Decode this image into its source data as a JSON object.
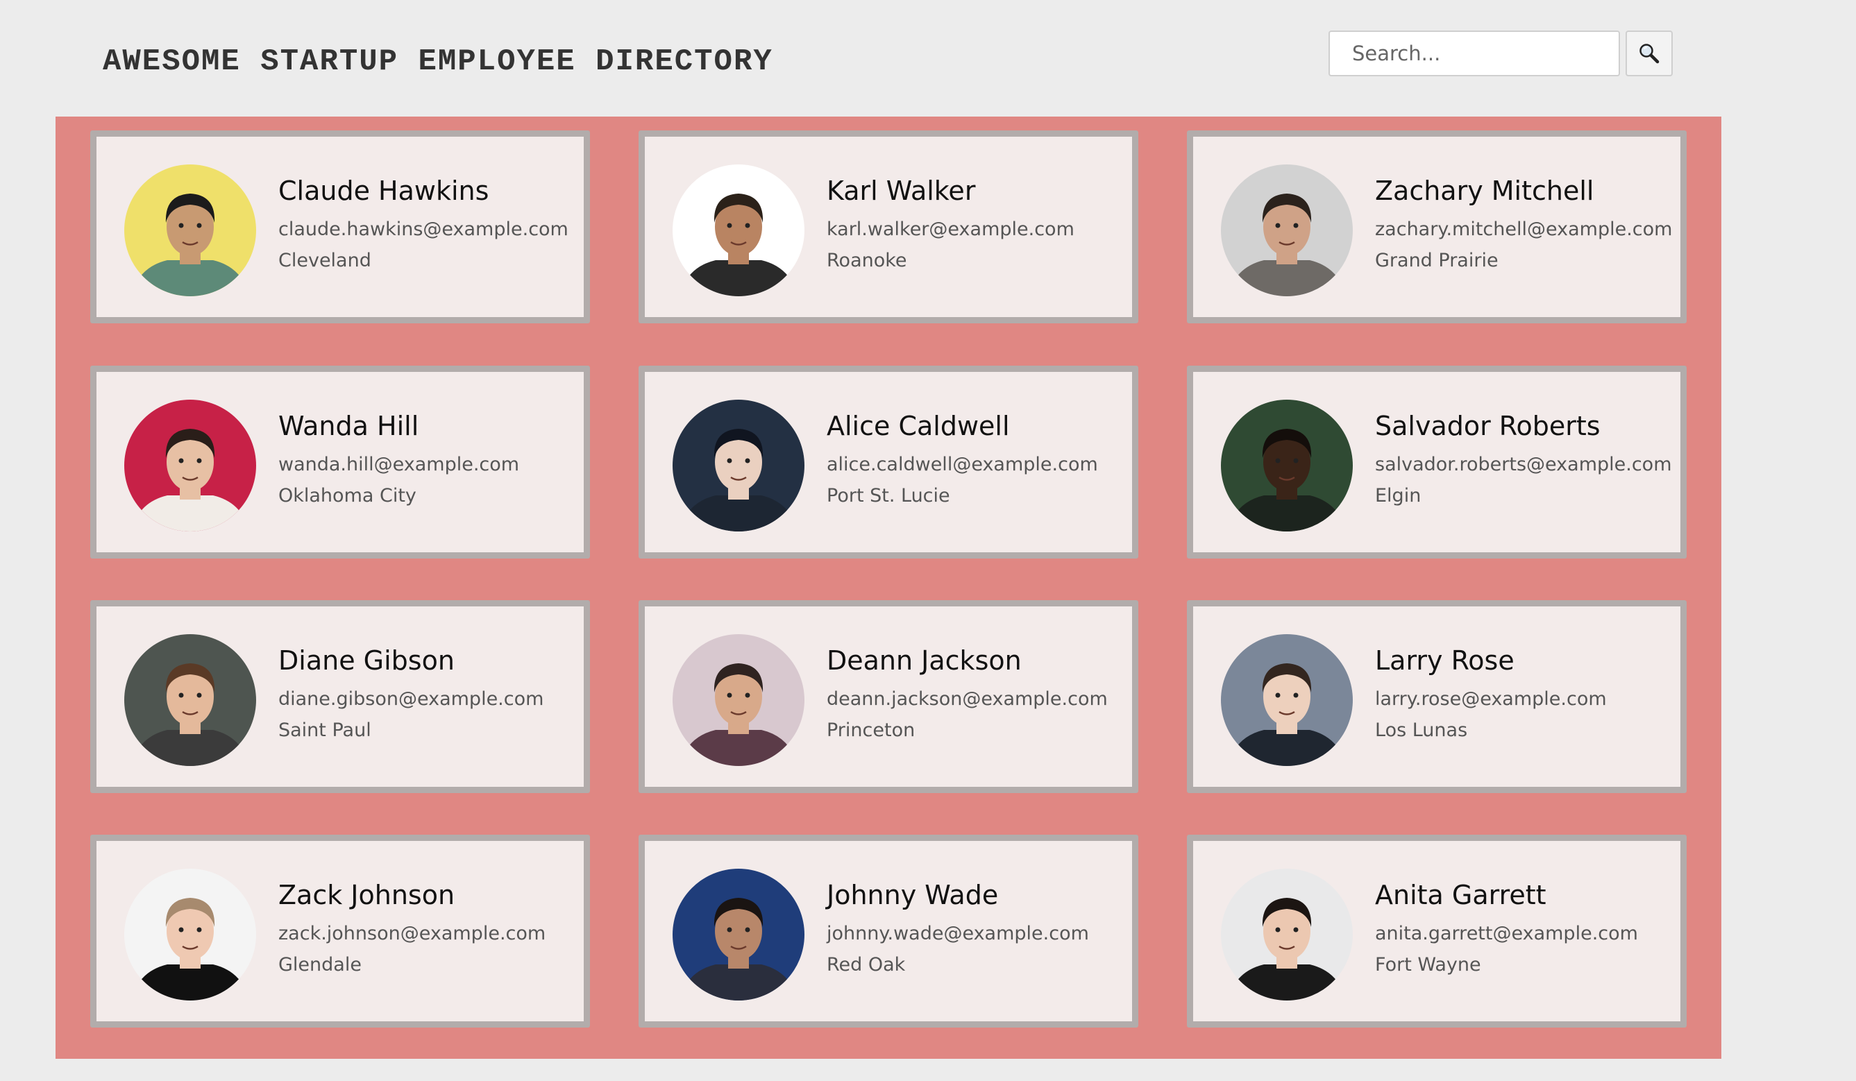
{
  "header": {
    "title": "AWESOME STARTUP EMPLOYEE DIRECTORY"
  },
  "search": {
    "placeholder": "Search...",
    "button_icon": "magnifier-icon"
  },
  "colors": {
    "page_background": "#ececec",
    "gallery_background": "#e08783",
    "card_background": "#f3ebea",
    "card_border": "#b2acab"
  },
  "employees": [
    {
      "name": "Claude Hawkins",
      "email": "claude.hawkins@example.com",
      "city": "Cleveland",
      "photo": "man-yellow-background",
      "bg": "#efe06a",
      "skin": "#c89a72",
      "hair": "#1b1b1b",
      "shirt": "#5d8a78"
    },
    {
      "name": "Karl Walker",
      "email": "karl.walker@example.com",
      "city": "Roanoke",
      "photo": "man-white-background",
      "bg": "#ffffff",
      "skin": "#b98462",
      "hair": "#2b2119",
      "shirt": "#2a2a2a"
    },
    {
      "name": "Zachary Mitchell",
      "email": "zachary.mitchell@example.com",
      "city": "Grand Prairie",
      "photo": "man-grey-background",
      "bg": "#d2d2d2",
      "skin": "#cfa287",
      "hair": "#2b221c",
      "shirt": "#6e6a66"
    },
    {
      "name": "Wanda Hill",
      "email": "wanda.hill@example.com",
      "city": "Oklahoma City",
      "photo": "woman-red-background",
      "bg": "#c72147",
      "skin": "#e7c0a4",
      "hair": "#2a1e19",
      "shirt": "#f1ece7"
    },
    {
      "name": "Alice Caldwell",
      "email": "alice.caldwell@example.com",
      "city": "Port St. Lucie",
      "photo": "woman-dark-background",
      "bg": "#233043",
      "skin": "#ead0c0",
      "hair": "#101520",
      "shirt": "#1d2633"
    },
    {
      "name": "Salvador Roberts",
      "email": "salvador.roberts@example.com",
      "city": "Elgin",
      "photo": "man-green-background",
      "bg": "#2f4a33",
      "skin": "#3a2418",
      "hair": "#140e0b",
      "shirt": "#1c241e"
    },
    {
      "name": "Diane Gibson",
      "email": "diane.gibson@example.com",
      "city": "Saint Paul",
      "photo": "woman-outdoor-background",
      "bg": "#4e5550",
      "skin": "#e4b99b",
      "hair": "#5a3a26",
      "shirt": "#3b3b3b"
    },
    {
      "name": "Deann Jackson",
      "email": "deann.jackson@example.com",
      "city": "Princeton",
      "photo": "woman-blossom-background",
      "bg": "#d8c8cf",
      "skin": "#d8a98a",
      "hair": "#2f2320",
      "shirt": "#5b3b48"
    },
    {
      "name": "Larry Rose",
      "email": "larry.rose@example.com",
      "city": "Los Lunas",
      "photo": "man-blue-grey-background",
      "bg": "#7b8799",
      "skin": "#edd0bd",
      "hair": "#33261f",
      "shirt": "#1f2630"
    },
    {
      "name": "Zack Johnson",
      "email": "zack.johnson@example.com",
      "city": "Glendale",
      "photo": "man-white-background",
      "bg": "#f4f4f4",
      "skin": "#efc9b2",
      "hair": "#a78a6e",
      "shirt": "#111111"
    },
    {
      "name": "Johnny Wade",
      "email": "johnny.wade@example.com",
      "city": "Red Oak",
      "photo": "man-blue-background",
      "bg": "#1f3d7a",
      "skin": "#b8876a",
      "hair": "#1a1412",
      "shirt": "#2a2e3d"
    },
    {
      "name": "Anita Garrett",
      "email": "anita.garrett@example.com",
      "city": "Fort Wayne",
      "photo": "woman-light-background",
      "bg": "#e9e9ea",
      "skin": "#ecc8b1",
      "hair": "#1c1512",
      "shirt": "#1a1a1a"
    }
  ]
}
